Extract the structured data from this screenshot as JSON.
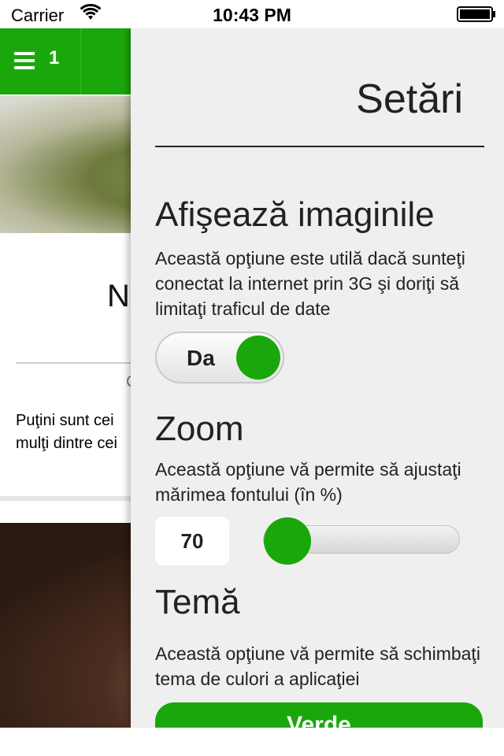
{
  "status_bar": {
    "carrier": "Carrier",
    "time": "10:43 PM"
  },
  "app_header": {
    "count": "1"
  },
  "article": {
    "title_fragment": "N",
    "meta_fragment": "C",
    "text_line1": "Puţini sunt cei",
    "text_line2": "mulţi dintre cei"
  },
  "settings": {
    "title": "Setări",
    "images": {
      "heading": "Afişează imaginile",
      "description": "Această opţiune este utilă dacă sunteţi conectat la internet prin 3G şi doriţi să limitaţi traficul de date",
      "toggle_label": "Da",
      "toggle_on": true
    },
    "zoom": {
      "heading": "Zoom",
      "description": "Această opţiune vă permite să ajustaţi mărimea fontului (în %)",
      "value": "70",
      "slider_fraction": 0.0
    },
    "theme": {
      "heading": "Temă",
      "description": "Această opţiune vă permite să schimbaţi tema de culori a aplicaţiei",
      "button_label": "Verde"
    }
  },
  "colors": {
    "accent": "#1aa70b",
    "panel_bg": "#efefef"
  }
}
